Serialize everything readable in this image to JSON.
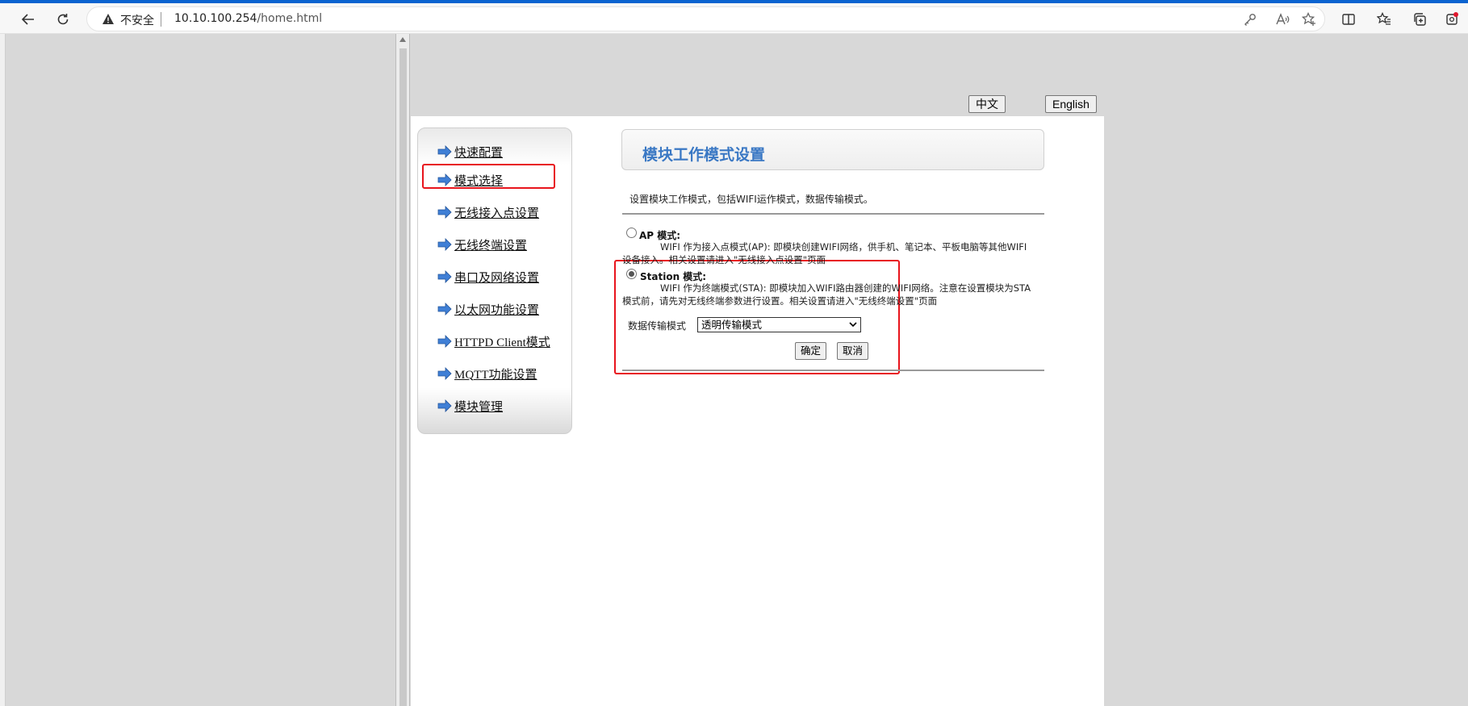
{
  "browser": {
    "security_label": "不安全",
    "url_host": "10.10.100.254",
    "url_path": "/home.html"
  },
  "lang": {
    "zh": "中文",
    "en": "English"
  },
  "menu": {
    "items": [
      {
        "label": "快速配置"
      },
      {
        "label": "模式选择"
      },
      {
        "label": "无线接入点设置"
      },
      {
        "label": "无线终端设置"
      },
      {
        "label": "串口及网络设置"
      },
      {
        "label": "以太网功能设置"
      },
      {
        "label": "HTTPD Client模式"
      },
      {
        "label": "MQTT功能设置"
      },
      {
        "label": "模块管理"
      }
    ]
  },
  "main": {
    "title": "模块工作模式设置",
    "description": "设置模块工作模式，包括WIFI运作模式，数据传输模式。",
    "ap": {
      "label": "AP 模式:",
      "line1": "WIFI 作为接入点模式(AP): 即模块创建WIFI网络，供手机、笔记本、平板电脑等其他WIFI",
      "line2": "设备接入。相关设置请进入\"无线接入点设置\"页面",
      "selected": false
    },
    "station": {
      "label": "Station 模式:",
      "line1": "WIFI 作为终端模式(STA): 即模块加入WIFI路由器创建的WIFI网络。注意在设置模块为STA",
      "line2": "模式前，请先对无线终端参数进行设置。相关设置请进入\"无线终端设置\"页面",
      "selected": true
    },
    "transfer_mode_label": "数据传输模式",
    "transfer_mode_value": "透明传输模式",
    "confirm_label": "确定",
    "cancel_label": "取消"
  },
  "colors": {
    "accent_title": "#3a78c4",
    "highlight_red": "#e8141c",
    "browser_progress": "#0a63d0"
  }
}
